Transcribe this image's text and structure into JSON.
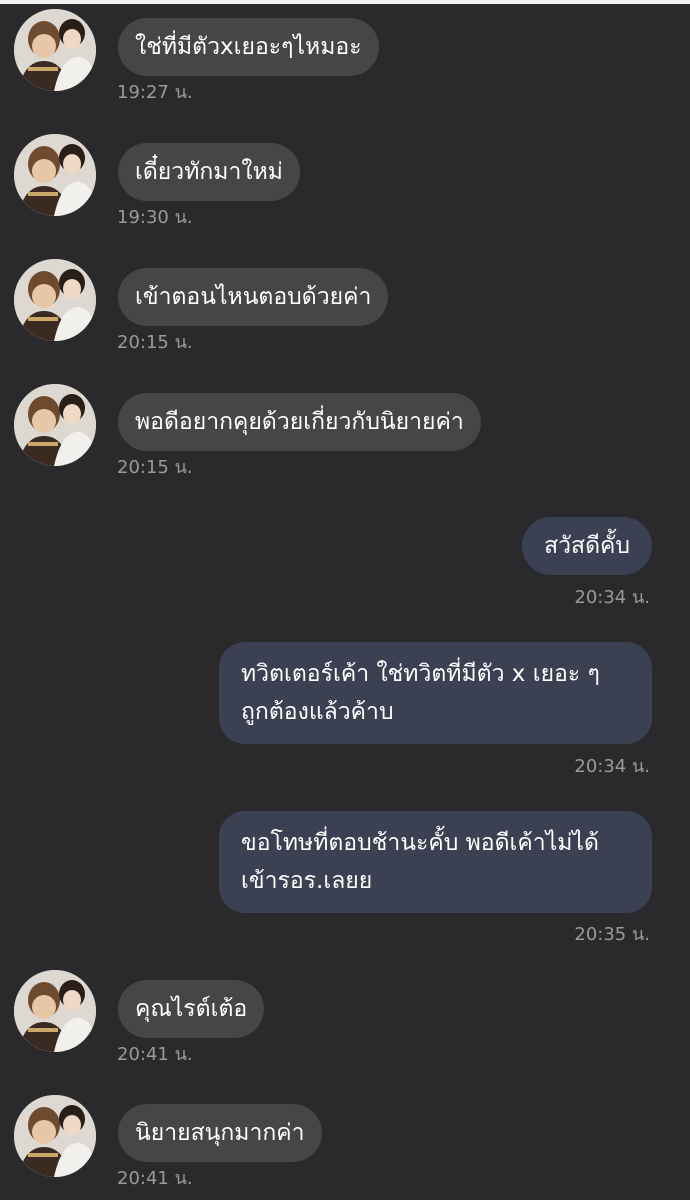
{
  "messages": [
    {
      "side": "in",
      "text": "ใช่ที่มีตัวxเยอะๆไหมอะ",
      "time": "19:27 น."
    },
    {
      "side": "in",
      "text": "เดี๋ยวทักมาใหม่",
      "time": "19:30 น."
    },
    {
      "side": "in",
      "text": "เข้าตอนไหนตอบด้วยค่า",
      "time": "20:15 น."
    },
    {
      "side": "in",
      "text": "พอดีอยากคุยด้วยเกี่ยวกับนิยายค่า",
      "time": "20:15 น."
    },
    {
      "side": "out",
      "text": "สวัสดีคั้บ",
      "time": "20:34 น."
    },
    {
      "side": "out",
      "lines": [
        "ทวิตเตอร์เค้า ใช่ทวิตที่มีตัว x เยอะ ๆ",
        "ถูกต้องแล้วค้าบ"
      ],
      "time": "20:34 น."
    },
    {
      "side": "out",
      "lines": [
        "ขอโทษที่ตอบช้านะคั้บ พอดีเค้าไม่ได้",
        "เข้ารอร.เลยย"
      ],
      "time": "20:35 น."
    },
    {
      "side": "in",
      "text": "คุณไรต์เต้อ",
      "time": "20:41 น."
    },
    {
      "side": "in",
      "text": "นิยายสนุกมากค่า",
      "time": "20:41 น."
    }
  ]
}
